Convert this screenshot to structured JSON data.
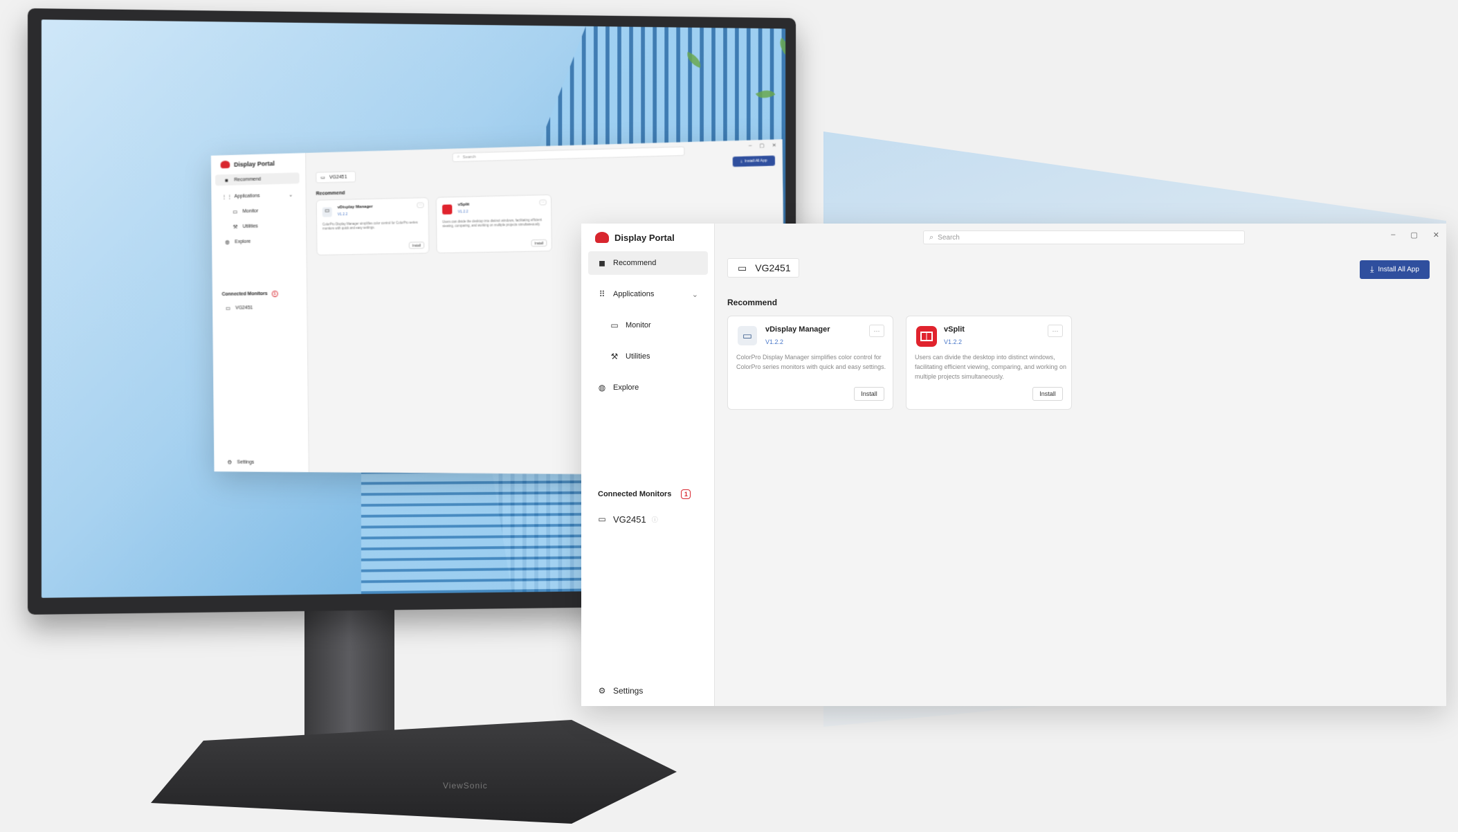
{
  "monitor": {
    "brand_text": "ViewSonic"
  },
  "app": {
    "title": "Display Portal",
    "search": {
      "placeholder": "Search"
    },
    "window_controls": {
      "minimize": "–",
      "maximize": "▢",
      "close": "✕"
    },
    "monitor_chip": "VG2451",
    "install_all_label": "Install All App",
    "nav": {
      "recommend": "Recommend",
      "applications": "Applications",
      "monitor": "Monitor",
      "utilities": "Utilities",
      "explore": "Explore"
    },
    "connected_monitors": {
      "label": "Connected Monitors",
      "count": "1",
      "items": [
        {
          "name": "VG2451"
        }
      ]
    },
    "settings_label": "Settings",
    "section_title": "Recommend",
    "cards": [
      {
        "name": "vDisplay Manager",
        "version": "V1.2.2",
        "description": "ColorPro Display Manager simplifies color control for ColorPro series monitors with quick and easy settings.",
        "install_label": "Install",
        "more": "···"
      },
      {
        "name": "vSplit",
        "version": "V1.2.2",
        "description": "Users can divide the desktop into distinct windows, facilitating efficient viewing, comparing, and working on multiple projects simultaneously.",
        "install_label": "Install",
        "more": "···"
      }
    ]
  },
  "icons": {
    "logo": "display-portal-logo",
    "recommend": "recommend-icon",
    "applications": "grid-icon",
    "monitor": "monitor-icon",
    "utilities": "wrench-icon",
    "explore": "globe-icon",
    "settings": "gear-icon",
    "search": "search-icon",
    "download": "download-icon"
  },
  "colors": {
    "accent": "#2f4f9e",
    "brand_red": "#d8262e"
  }
}
